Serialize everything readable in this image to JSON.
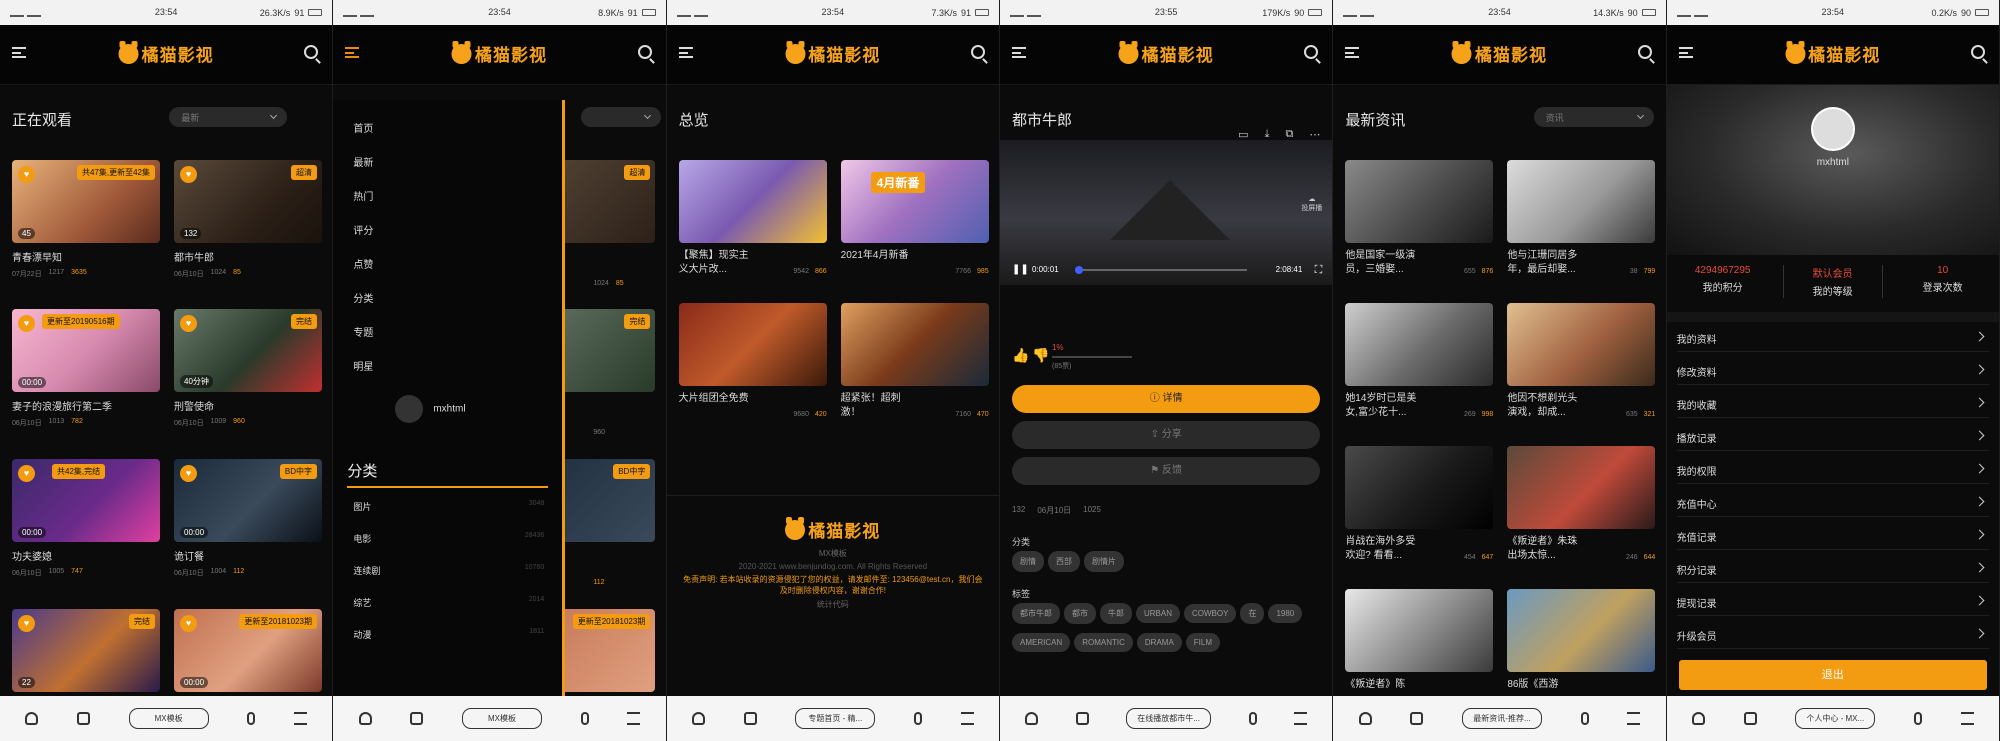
{
  "app": {
    "name": "橘猫影视"
  },
  "screens": [
    {
      "id": "s1",
      "status": {
        "time": "23:54",
        "net": "26.3K/s",
        "battery": "91"
      },
      "title": "正在观看",
      "select": "最新",
      "nav_pill": "MX模板",
      "cards": [
        {
          "title": "青春漂早知",
          "badge": "共47集,更新至42集",
          "dur": "45",
          "date": "07月22日",
          "views": "1217",
          "likes": "3635"
        },
        {
          "title": "都市牛郎",
          "badge": "超清",
          "dur": "132",
          "date": "06月10日",
          "views": "1024",
          "likes": "85"
        },
        {
          "title": "妻子的浪漫旅行第二季",
          "badge": "更新至20190516期",
          "dur": "00:00",
          "date": "06月10日",
          "views": "1013",
          "likes": "782"
        },
        {
          "title": "刑警使命",
          "badge": "完结",
          "dur": "40分钟",
          "date": "06月10日",
          "views": "1009",
          "likes": "960"
        },
        {
          "title": "功夫婆媳",
          "badge": "共42集,完结",
          "dur": "00:00",
          "date": "06月10日",
          "views": "1005",
          "likes": "747"
        },
        {
          "title": "诡订餐",
          "badge": "BD中字",
          "dur": "00:00",
          "date": "06月10日",
          "views": "1004",
          "likes": "112"
        },
        {
          "title": "",
          "badge": "完结",
          "dur": "22",
          "date": "",
          "views": "",
          "likes": ""
        },
        {
          "title": "",
          "badge": "更新至20181023期",
          "dur": "00:00",
          "date": "",
          "views": "",
          "likes": ""
        }
      ]
    },
    {
      "id": "s2",
      "status": {
        "time": "23:54",
        "net": "8.9K/s",
        "battery": "91"
      },
      "nav_pill": "MX模板",
      "menu": [
        "首页",
        "最新",
        "热门",
        "评分",
        "点赞",
        "分类",
        "专题",
        "明星"
      ],
      "user": "mxhtml",
      "cat_title": "分类",
      "categories": [
        {
          "name": "图片",
          "count": "3048"
        },
        {
          "name": "电影",
          "count": "28436"
        },
        {
          "name": "连续剧",
          "count": "10760"
        },
        {
          "name": "综艺",
          "count": "2014"
        },
        {
          "name": "动漫",
          "count": "1811"
        }
      ],
      "bg_badges": [
        "超清",
        "完结",
        "BD中字",
        "更新至20181023期"
      ],
      "bg_meta": [
        "1024",
        "85",
        "960",
        "112"
      ]
    },
    {
      "id": "s3",
      "status": {
        "time": "23:54",
        "net": "7.3K/s",
        "battery": "91"
      },
      "title": "总览",
      "nav_pill": "专题首页 - 精...",
      "items": [
        {
          "title": "【聚焦】现实主义大片改...",
          "views": "9542",
          "likes": "866"
        },
        {
          "title": "2021年4月新番",
          "views": "7766",
          "likes": "985"
        },
        {
          "title": "大片组团全免费",
          "views": "9680",
          "likes": "420"
        },
        {
          "title": "超紧张！超刺激！",
          "views": "7160",
          "likes": "470"
        }
      ],
      "banner_text": "4月新番",
      "footer": {
        "logo": "橘猫影视",
        "tpl": "MX模板",
        "copy": "2020-2021 www.benjundog.com. All Rights Reserved",
        "notice": "免责声明: 若本站收录的资源侵犯了您的权益，请发邮件至: 123456@test.cn，我们会及时删除侵权内容，谢谢合作!",
        "stat": "统计代码"
      }
    },
    {
      "id": "s4",
      "status": {
        "time": "23:55",
        "net": "179K/s",
        "battery": "90"
      },
      "title": "都市牛郎",
      "nav_pill": "在线播放都市牛...",
      "player": {
        "cur": "0:00:01",
        "total": "2:08:41",
        "cast": "投屏播"
      },
      "rate": {
        "pct": "1%",
        "count": "(85票)"
      },
      "buttons": {
        "detail": "详情",
        "share": "分享",
        "report": "反馈"
      },
      "info": {
        "views": "132",
        "date": "06月10日",
        "likes": "1025"
      },
      "cat_label": "分类",
      "cats": [
        "剧情",
        "西部",
        "剧情片"
      ],
      "tag_label": "标签",
      "tags": [
        "都市牛郎",
        "都市",
        "牛郎",
        "URBAN",
        "COWBOY",
        "在",
        "1980",
        "AMERICAN",
        "ROMANTIC",
        "DRAMA",
        "FILM"
      ]
    },
    {
      "id": "s5",
      "status": {
        "time": "23:54",
        "net": "14.3K/s",
        "battery": "90"
      },
      "title": "最新资讯",
      "select": "资讯",
      "nav_pill": "最新资讯-推荐...",
      "items": [
        {
          "title": "他是国家一级演员，三婚娶...",
          "views": "655",
          "likes": "876"
        },
        {
          "title": "他与江珊同居多年，最后却娶...",
          "views": "38",
          "likes": "799"
        },
        {
          "title": "她14岁时已是美女,富少花十...",
          "views": "269",
          "likes": "998"
        },
        {
          "title": "他因不想剃光头演戏，却成...",
          "views": "635",
          "likes": "321"
        },
        {
          "title": "肖战在海外多受欢迎? 看看...",
          "views": "454",
          "likes": "647"
        },
        {
          "title": "《叛逆者》朱珠出场太惊...",
          "views": "246",
          "likes": "644"
        },
        {
          "title": "《叛逆者》陈",
          "views": "",
          "likes": ""
        },
        {
          "title": "86版《西游",
          "views": "",
          "likes": ""
        }
      ]
    },
    {
      "id": "s6",
      "status": {
        "time": "23:54",
        "net": "0.2K/s",
        "battery": "90"
      },
      "user": "mxhtml",
      "nav_pill": "个人中心 - MX...",
      "stats": [
        {
          "value": "4294967295",
          "label": "我的积分"
        },
        {
          "value": "默认会员",
          "label": "我的等级"
        },
        {
          "value": "10",
          "label": "登录次数"
        }
      ],
      "menu": [
        "我的资料",
        "修改资料",
        "我的收藏",
        "播放记录",
        "我的权限",
        "充值中心",
        "充值记录",
        "积分记录",
        "提现记录",
        "升级会员"
      ],
      "logout": "退出"
    }
  ],
  "colors": {
    "accent": "#f39c12",
    "bg": "#0b0b0b",
    "red": "#e74c3c"
  }
}
